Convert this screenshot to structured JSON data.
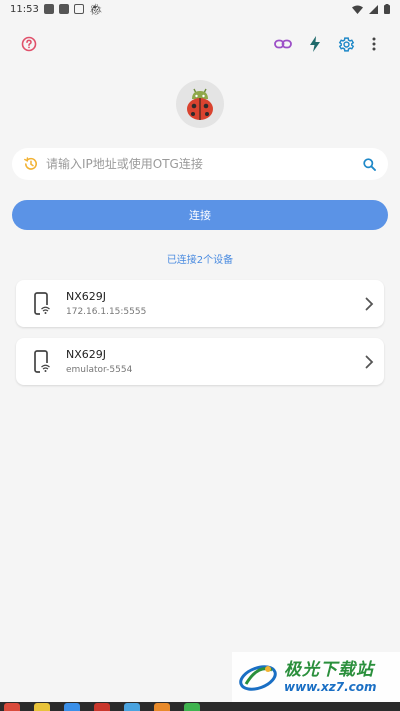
{
  "status_bar": {
    "time": "11:53"
  },
  "toolbar": {
    "icons": {
      "help": "help-circle-icon",
      "link": "link-icon",
      "flash": "lightning-icon",
      "settings": "gear-icon",
      "menu": "more-vert-icon"
    },
    "colors": {
      "help": "#e0506a",
      "link": "#9c4fc7",
      "flash": "#1f6a6b",
      "settings": "#1e88c8"
    }
  },
  "search": {
    "placeholder": "请输入IP地址或使用OTG连接",
    "value": ""
  },
  "connect_button": {
    "label": "连接",
    "color": "#5b93e6"
  },
  "connected_count": "已连接2个设备",
  "devices": [
    {
      "name": "NX629J",
      "address": "172.16.1.15:5555"
    },
    {
      "name": "NX629J",
      "address": "emulator-5554"
    }
  ],
  "watermark": {
    "title": "极光下载站",
    "url": "www.xz7.com"
  }
}
